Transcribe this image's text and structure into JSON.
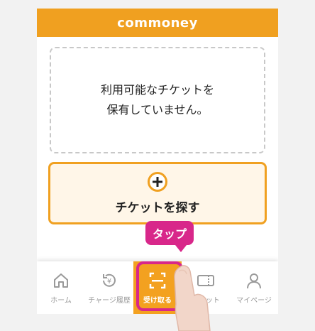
{
  "header": {
    "logo": "commoney"
  },
  "empty_state": {
    "line1": "利用可能なチケットを",
    "line2": "保有していません。"
  },
  "find_ticket": {
    "label": "チケットを探す",
    "icon": "plus-circle-icon"
  },
  "tabs": [
    {
      "label": "ホーム",
      "icon": "home-icon",
      "active": false
    },
    {
      "label": "チャージ履歴",
      "icon": "charge-history-icon",
      "active": false
    },
    {
      "label": "受け取る",
      "icon": "scan-icon",
      "active": true
    },
    {
      "label": "チケット",
      "icon": "ticket-icon",
      "active": false
    },
    {
      "label": "マイページ",
      "icon": "user-icon",
      "active": false
    }
  ],
  "callout": {
    "text": "タップ"
  },
  "colors": {
    "brand_orange": "#f0a020",
    "highlight_pink": "#d8278a",
    "tab_inactive": "#9a9a9a"
  }
}
